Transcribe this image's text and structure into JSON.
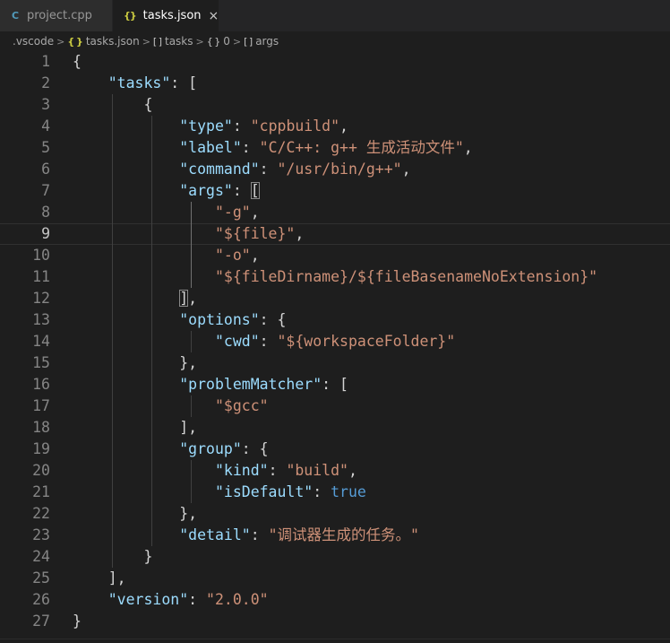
{
  "tabs": [
    {
      "label": "project.cpp",
      "icon": "c-file-icon",
      "active": false
    },
    {
      "label": "tasks.json",
      "icon": "json-file-icon",
      "active": true,
      "close_glyph": "×"
    }
  ],
  "breadcrumb": {
    "folder": ".vscode",
    "file": "tasks.json",
    "array_icon": "[ ]",
    "object_icon": "{ }",
    "file_icon": "{ }",
    "tasks": "tasks",
    "index": "0",
    "args": "args",
    "separator": ">"
  },
  "editor": {
    "current_line": 9,
    "lines": [
      {
        "n": "1",
        "indent": "",
        "parts": [
          {
            "t": "pun",
            "v": "{"
          }
        ]
      },
      {
        "n": "2",
        "indent": "    ",
        "parts": [
          {
            "t": "key",
            "v": "\"tasks\""
          },
          {
            "t": "pun",
            "v": ": ["
          }
        ]
      },
      {
        "n": "3",
        "indent": "        ",
        "parts": [
          {
            "t": "pun",
            "v": "{"
          }
        ]
      },
      {
        "n": "4",
        "indent": "            ",
        "parts": [
          {
            "t": "key",
            "v": "\"type\""
          },
          {
            "t": "pun",
            "v": ": "
          },
          {
            "t": "str",
            "v": "\"cppbuild\""
          },
          {
            "t": "pun",
            "v": ","
          }
        ]
      },
      {
        "n": "5",
        "indent": "            ",
        "parts": [
          {
            "t": "key",
            "v": "\"label\""
          },
          {
            "t": "pun",
            "v": ": "
          },
          {
            "t": "str",
            "v": "\"C/C++: g++ 生成活动文件\""
          },
          {
            "t": "pun",
            "v": ","
          }
        ]
      },
      {
        "n": "6",
        "indent": "            ",
        "parts": [
          {
            "t": "key",
            "v": "\"command\""
          },
          {
            "t": "pun",
            "v": ": "
          },
          {
            "t": "str",
            "v": "\"/usr/bin/g++\""
          },
          {
            "t": "pun",
            "v": ","
          }
        ]
      },
      {
        "n": "7",
        "indent": "            ",
        "parts": [
          {
            "t": "key",
            "v": "\"args\""
          },
          {
            "t": "pun",
            "v": ": "
          },
          {
            "t": "bm",
            "v": "["
          }
        ]
      },
      {
        "n": "8",
        "indent": "                ",
        "parts": [
          {
            "t": "str",
            "v": "\"-g\""
          },
          {
            "t": "pun",
            "v": ","
          }
        ]
      },
      {
        "n": "9",
        "indent": "                ",
        "parts": [
          {
            "t": "str",
            "v": "\"${file}\""
          },
          {
            "t": "pun",
            "v": ","
          }
        ]
      },
      {
        "n": "10",
        "indent": "                ",
        "parts": [
          {
            "t": "str",
            "v": "\"-o\""
          },
          {
            "t": "pun",
            "v": ","
          }
        ]
      },
      {
        "n": "11",
        "indent": "                ",
        "parts": [
          {
            "t": "str",
            "v": "\"${fileDirname}/${fileBasenameNoExtension}\""
          }
        ]
      },
      {
        "n": "12",
        "indent": "            ",
        "parts": [
          {
            "t": "bm",
            "v": "]"
          },
          {
            "t": "pun",
            "v": ","
          }
        ]
      },
      {
        "n": "13",
        "indent": "            ",
        "parts": [
          {
            "t": "key",
            "v": "\"options\""
          },
          {
            "t": "pun",
            "v": ": {"
          }
        ]
      },
      {
        "n": "14",
        "indent": "                ",
        "parts": [
          {
            "t": "key",
            "v": "\"cwd\""
          },
          {
            "t": "pun",
            "v": ": "
          },
          {
            "t": "str",
            "v": "\"${workspaceFolder}\""
          }
        ]
      },
      {
        "n": "15",
        "indent": "            ",
        "parts": [
          {
            "t": "pun",
            "v": "},"
          }
        ]
      },
      {
        "n": "16",
        "indent": "            ",
        "parts": [
          {
            "t": "key",
            "v": "\"problemMatcher\""
          },
          {
            "t": "pun",
            "v": ": ["
          }
        ]
      },
      {
        "n": "17",
        "indent": "                ",
        "parts": [
          {
            "t": "str",
            "v": "\"$gcc\""
          }
        ]
      },
      {
        "n": "18",
        "indent": "            ",
        "parts": [
          {
            "t": "pun",
            "v": "],"
          }
        ]
      },
      {
        "n": "19",
        "indent": "            ",
        "parts": [
          {
            "t": "key",
            "v": "\"group\""
          },
          {
            "t": "pun",
            "v": ": {"
          }
        ]
      },
      {
        "n": "20",
        "indent": "                ",
        "parts": [
          {
            "t": "key",
            "v": "\"kind\""
          },
          {
            "t": "pun",
            "v": ": "
          },
          {
            "t": "str",
            "v": "\"build\""
          },
          {
            "t": "pun",
            "v": ","
          }
        ]
      },
      {
        "n": "21",
        "indent": "                ",
        "parts": [
          {
            "t": "key",
            "v": "\"isDefault\""
          },
          {
            "t": "pun",
            "v": ": "
          },
          {
            "t": "bool",
            "v": "true"
          }
        ]
      },
      {
        "n": "22",
        "indent": "            ",
        "parts": [
          {
            "t": "pun",
            "v": "},"
          }
        ]
      },
      {
        "n": "23",
        "indent": "            ",
        "parts": [
          {
            "t": "key",
            "v": "\"detail\""
          },
          {
            "t": "pun",
            "v": ": "
          },
          {
            "t": "str",
            "v": "\"调试器生成的任务。\""
          }
        ]
      },
      {
        "n": "24",
        "indent": "        ",
        "parts": [
          {
            "t": "pun",
            "v": "}"
          }
        ]
      },
      {
        "n": "25",
        "indent": "    ",
        "parts": [
          {
            "t": "pun",
            "v": "],"
          }
        ]
      },
      {
        "n": "26",
        "indent": "    ",
        "parts": [
          {
            "t": "key",
            "v": "\"version\""
          },
          {
            "t": "pun",
            "v": ": "
          },
          {
            "t": "str",
            "v": "\"2.0.0\""
          }
        ]
      },
      {
        "n": "27",
        "indent": "",
        "parts": [
          {
            "t": "pun",
            "v": "}"
          }
        ]
      }
    ]
  },
  "colors": {
    "editor_bg": "#1e1e1e",
    "key": "#9cdcfe",
    "string": "#ce9178",
    "boolean": "#569cd6",
    "punctuation": "#d4d4d4",
    "line_number": "#858585"
  }
}
